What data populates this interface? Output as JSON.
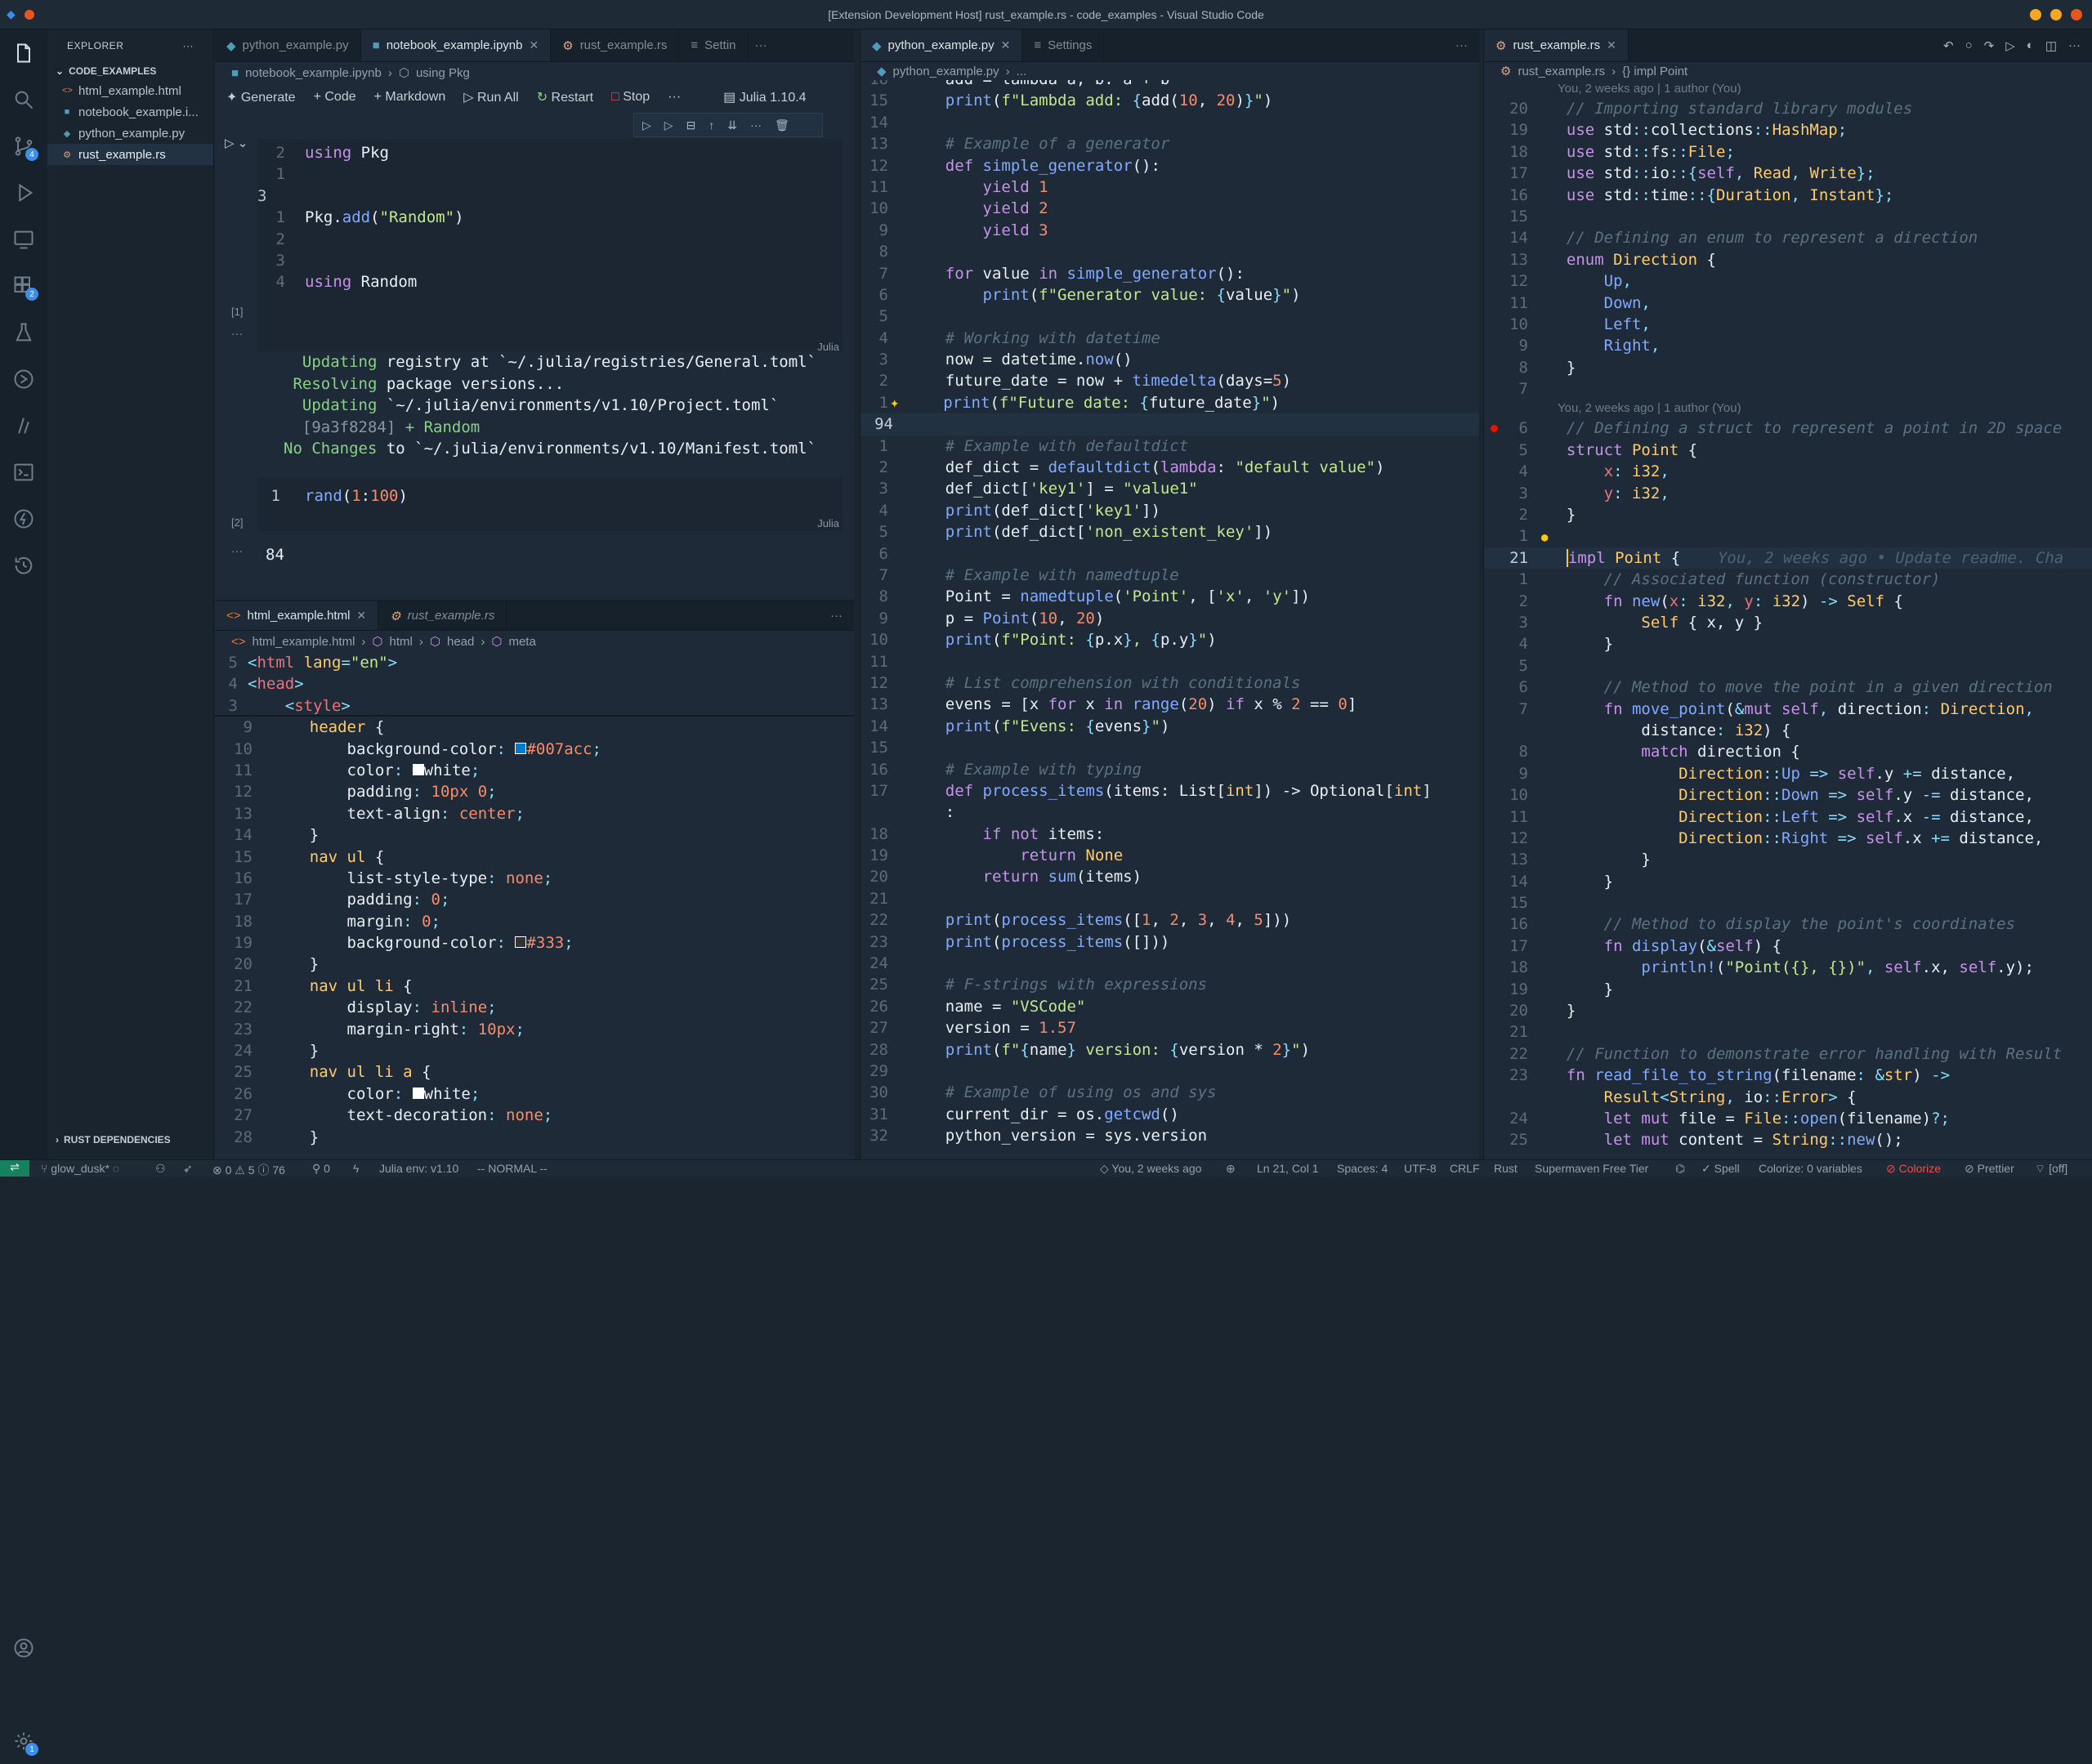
{
  "window": {
    "title": "[Extension Development Host] rust_example.rs - code_examples - Visual Studio Code"
  },
  "explorer": {
    "header": "EXPLORER",
    "folder": "CODE_EXAMPLES",
    "files": [
      "html_example.html",
      "notebook_example.i...",
      "python_example.py",
      "rust_example.rs"
    ],
    "footer": "RUST DEPENDENCIES"
  },
  "activity": {
    "badges": {
      "scm": "4",
      "extensions": "2",
      "settings": "1"
    }
  },
  "group1": {
    "tabs": [
      "python_example.py",
      "notebook_example.ipynb",
      "rust_example.rs",
      "Settin"
    ],
    "breadcrumb": [
      "notebook_example.ipynb",
      "using Pkg"
    ],
    "toolbar": {
      "generate": "Generate",
      "code": "Code",
      "markdown": "Markdown",
      "run_all": "Run All",
      "restart": "Restart",
      "stop": "Stop",
      "kernel": "Julia 1.10.4"
    },
    "cells": [
      {
        "index": "[1]",
        "lang": "Julia",
        "lines": [
          {
            "n": "2",
            "code": "using Pkg"
          },
          {
            "n": "1",
            "code": ""
          },
          {
            "n": "3",
            "code": ""
          },
          {
            "n": "1",
            "code": "Pkg.add(\"Random\")"
          },
          {
            "n": "2",
            "code": ""
          },
          {
            "n": "3",
            "code": ""
          },
          {
            "n": "4",
            "code": "using Random"
          }
        ]
      },
      {
        "index": "[2]",
        "lang": "Julia",
        "lines": [
          {
            "n": "1",
            "code": "rand(1:100)"
          }
        ]
      }
    ],
    "output1": [
      {
        "h": "  Updating",
        "r": " registry at `~/.julia/registries/General.toml`"
      },
      {
        "h": " Resolving",
        "r": " package versions..."
      },
      {
        "h": "  Updating",
        "r": " `~/.julia/environments/v1.10/Project.toml`"
      },
      {
        "h": "  [9a3f8284]",
        "r": " + Random"
      },
      {
        "h": "No Changes",
        "r": " to `~/.julia/environments/v1.10/Manifest.toml`"
      }
    ],
    "output2": "84"
  },
  "group1b": {
    "tabs": [
      "html_example.html",
      "rust_example.rs"
    ],
    "breadcrumb": [
      "html_example.html",
      "html",
      "head",
      "meta"
    ]
  },
  "group2": {
    "tabs": [
      "python_example.py",
      "Settings"
    ],
    "breadcrumb": [
      "python_example.py",
      "..."
    ],
    "current_line": "94"
  },
  "group3": {
    "tabs": [
      "rust_example.rs"
    ],
    "breadcrumb": [
      "rust_example.rs",
      "{} impl Point"
    ],
    "blame1": "You, 2 weeks ago | 1 author (You)",
    "blame2": "You, 2 weeks ago | 1 author (You)",
    "inline_blame": "You, 2 weeks ago • Update readme. Cha"
  },
  "status": {
    "branch": "glow_dusk*",
    "problems": "0",
    "warnings": "5",
    "info": "76",
    "ports": "0",
    "julia": "Julia env: v1.10",
    "mode": "-- NORMAL --",
    "blame": "You, 2 weeks ago",
    "pos": "Ln 21, Col 1",
    "spaces": "Spaces: 4",
    "enc": "UTF-8",
    "eol": "CRLF",
    "lang": "Rust",
    "supermaven": "Supermaven Free Tier",
    "spell": "Spell",
    "colorize": "Colorize: 0 variables",
    "colorize2": "Colorize",
    "prettier": "Prettier",
    "off": "[off]"
  }
}
